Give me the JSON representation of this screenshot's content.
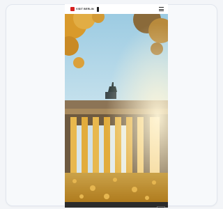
{
  "header": {
    "brand": "VISIT BERLIN",
    "brand_sub": "",
    "lang": "",
    "logo_color": "#d6201f"
  },
  "hero": {
    "subject": "",
    "sky_color": "#a9d3e6",
    "foliage_color": "#e0a640"
  },
  "cookie_banner": {
    "text": "",
    "button_label": ""
  },
  "icons": [
    "logo-mark-icon",
    "bear-flag-icon",
    "menu-icon"
  ]
}
